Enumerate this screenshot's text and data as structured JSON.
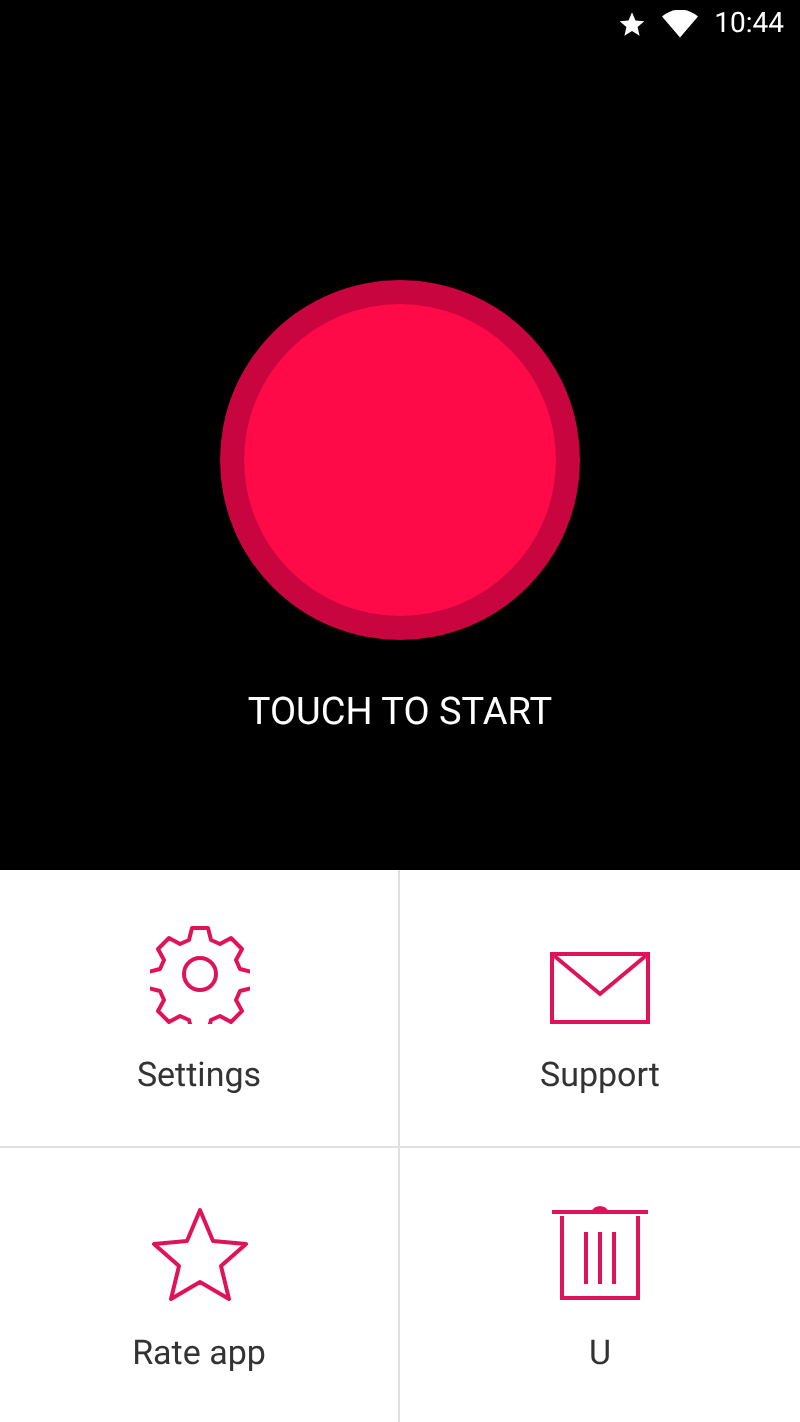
{
  "status_bar": {
    "time": "10:44"
  },
  "start_button": {
    "label": "TOUCH TO START"
  },
  "menu": [
    {
      "kind": "settings",
      "label": "Settings"
    },
    {
      "kind": "support",
      "label": "Support"
    },
    {
      "kind": "rate",
      "label": "Rate app"
    },
    {
      "kind": "trash",
      "label": "U"
    }
  ]
}
